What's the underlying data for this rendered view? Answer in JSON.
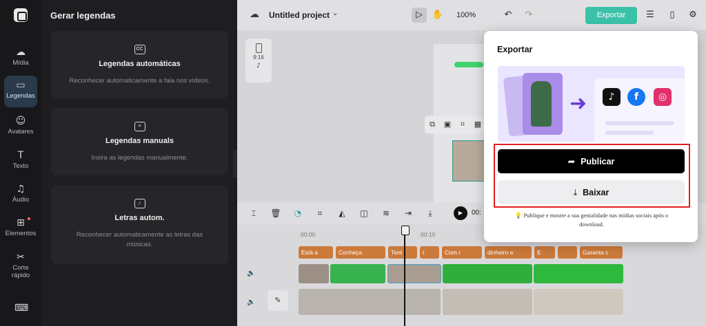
{
  "rail": {
    "items": [
      {
        "label": "Mídia",
        "icon": "media-upload-icon"
      },
      {
        "label": "Legendas",
        "icon": "captions-icon"
      },
      {
        "label": "Avatares",
        "icon": "avatar-icon"
      },
      {
        "label": "Texto",
        "icon": "text-icon"
      },
      {
        "label": "Áudio",
        "icon": "music-icon"
      },
      {
        "label": "Elementos",
        "icon": "elements-icon"
      },
      {
        "label": "Corte rápido",
        "icon": "quick-cut-icon"
      }
    ]
  },
  "panel": {
    "title": "Gerar legendas",
    "cards": [
      {
        "title": "Legendas automáticas",
        "desc": "Reconhecer automaticamente a fala nos vídeos."
      },
      {
        "title": "Legendas manuals",
        "desc": "Insira as legendas manualmente."
      },
      {
        "title": "Letras autom.",
        "desc": "Reconhecer automaticamente as letras das músicas."
      }
    ]
  },
  "topbar": {
    "project": "Untitled project",
    "zoom": "100%",
    "export": "Exportar"
  },
  "canvas": {
    "ratio": "9:16"
  },
  "timeline": {
    "time": "00:",
    "ruler": [
      "00:00",
      "00:10"
    ],
    "caption_chips": [
      "Está a",
      "Conheça",
      "Tent",
      "t",
      "Com r",
      "dinheiro e",
      "E",
      "",
      "Garanta c"
    ]
  },
  "modal": {
    "title": "Exportar",
    "publish": "Publicar",
    "download": "Baixar",
    "hint": "Publique e mostre a sua genialidade nas mídias sociais após o download."
  },
  "colors": {
    "accent": "#3cc1a9",
    "caption_chip": "#cc7a3a",
    "highlight": "#e02020"
  }
}
